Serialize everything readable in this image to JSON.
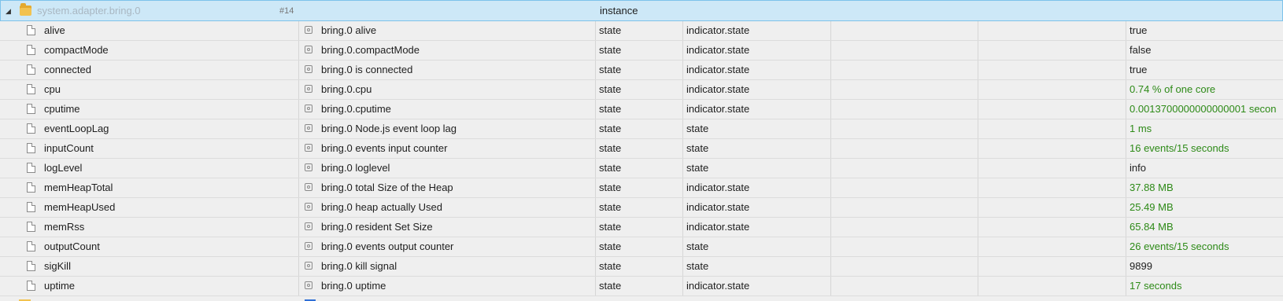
{
  "header": {
    "expander": "◢",
    "id": "system.adapter.bring.0",
    "count": "#14",
    "name": "bring",
    "type": "instance"
  },
  "rows": [
    {
      "id": "alive",
      "name": "bring.0 alive",
      "type": "state",
      "role": "indicator.state",
      "value": "true",
      "green": false
    },
    {
      "id": "compactMode",
      "name": "bring.0.compactMode",
      "type": "state",
      "role": "indicator.state",
      "value": "false",
      "green": false
    },
    {
      "id": "connected",
      "name": "bring.0 is connected",
      "type": "state",
      "role": "indicator.state",
      "value": "true",
      "green": false
    },
    {
      "id": "cpu",
      "name": "bring.0.cpu",
      "type": "state",
      "role": "indicator.state",
      "value": "0.74 % of one core",
      "green": true
    },
    {
      "id": "cputime",
      "name": "bring.0.cputime",
      "type": "state",
      "role": "indicator.state",
      "value": "0.0013700000000000001 secon",
      "green": true
    },
    {
      "id": "eventLoopLag",
      "name": "bring.0 Node.js event loop lag",
      "type": "state",
      "role": "state",
      "value": "1 ms",
      "green": true
    },
    {
      "id": "inputCount",
      "name": "bring.0 events input counter",
      "type": "state",
      "role": "state",
      "value": "16 events/15 seconds",
      "green": true
    },
    {
      "id": "logLevel",
      "name": "bring.0 loglevel",
      "type": "state",
      "role": "state",
      "value": "info",
      "green": false
    },
    {
      "id": "memHeapTotal",
      "name": "bring.0 total Size of the Heap",
      "type": "state",
      "role": "indicator.state",
      "value": "37.88 MB",
      "green": true
    },
    {
      "id": "memHeapUsed",
      "name": "bring.0 heap actually Used",
      "type": "state",
      "role": "indicator.state",
      "value": "25.49 MB",
      "green": true
    },
    {
      "id": "memRss",
      "name": "bring.0 resident Set Size",
      "type": "state",
      "role": "indicator.state",
      "value": "65.84 MB",
      "green": true
    },
    {
      "id": "outputCount",
      "name": "bring.0 events output counter",
      "type": "state",
      "role": "state",
      "value": "26 events/15 seconds",
      "green": true
    },
    {
      "id": "sigKill",
      "name": "bring.0 kill signal",
      "type": "state",
      "role": "state",
      "value": "9899",
      "green": false
    },
    {
      "id": "uptime",
      "name": "bring.0 uptime",
      "type": "state",
      "role": "indicator.state",
      "value": "17 seconds",
      "green": true
    }
  ],
  "colors": {
    "header_bg": "#cde8f7",
    "header_border": "#7dc2ea",
    "value_green": "#2d8a17",
    "row_bg": "#efefef"
  }
}
